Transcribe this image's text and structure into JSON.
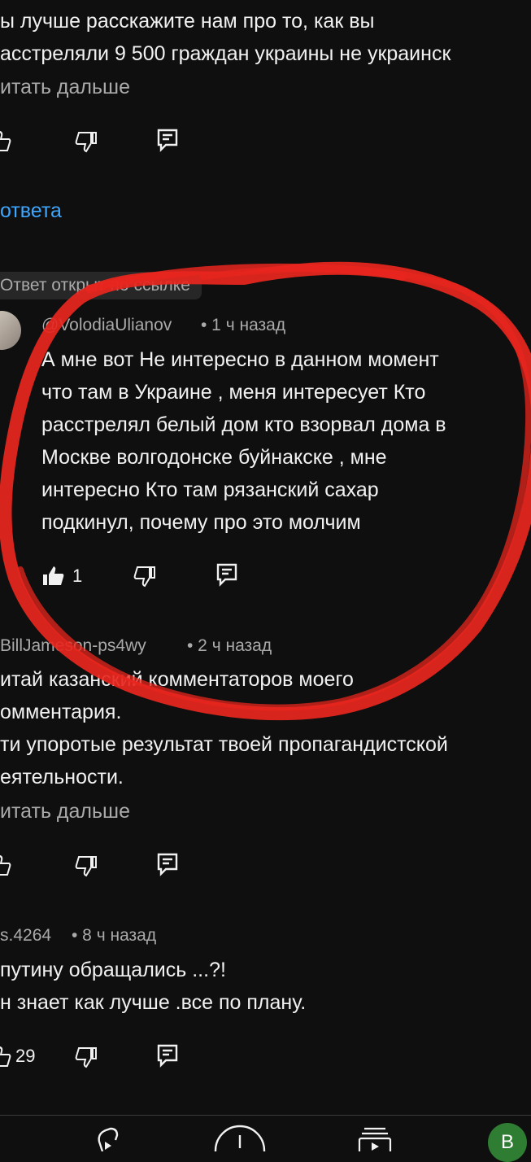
{
  "comment1": {
    "lines": [
      "ы лучше расскажите нам про то, как вы",
      "асстреляли 9 500 граждан украины не украинск"
    ],
    "read_more": "итать дальше"
  },
  "replies_link": "ответа",
  "highlight_badge": "Ответ открыт по ссылке",
  "highlighted": {
    "author": "@VolodiaUlianov",
    "time": "• 1 ч назад",
    "lines": [
      "А мне вот Не интересно в данном момент",
      "что там в Украине , меня интересует Кто",
      "расстрелял белый дом кто взорвал дома в",
      "Москве волгодонске буйнакске , мне",
      "интересно Кто там рязанский сахар",
      "подкинул, почему про это молчим"
    ],
    "likes": "1"
  },
  "comment3": {
    "author": "BillJameson-ps4wy",
    "time": "• 2 ч назад",
    "lines": [
      "итай казанский комментаторов моего",
      "омментария.",
      "ти упоротые результат твоей пропагандистской",
      "еятельности."
    ],
    "read_more": "итать дальше"
  },
  "comment4": {
    "author": "s.4264",
    "time": "• 8 ч назад",
    "lines": [
      "путину обращались ...?!",
      "н знает как лучше .все по плану."
    ],
    "likes": "29"
  },
  "nav": {
    "profile_initial": "B"
  },
  "colors": {
    "background": "#0f0f0f",
    "link": "#3ea6ff",
    "circle_annotation": "#e8261e"
  }
}
